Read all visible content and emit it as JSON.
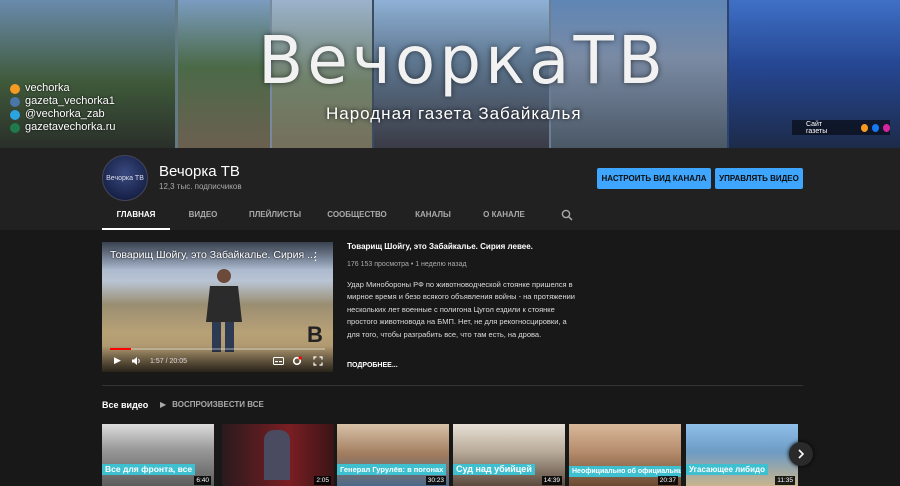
{
  "banner": {
    "title": "ВечоркаТВ",
    "subtitle": "Народная газета Забайкалья",
    "social": [
      {
        "icon": "ok-icon",
        "text": "vechorka"
      },
      {
        "icon": "vk-icon",
        "text": "gazeta_vechorka1"
      },
      {
        "icon": "telegram-icon",
        "text": "@vechorka_zab"
      },
      {
        "icon": "globe-icon",
        "text": "gazetavechorka.ru"
      }
    ],
    "site_link": "Сайт газеты"
  },
  "channel": {
    "name": "Вечорка ТВ",
    "avatar_text": "Вечорка ТВ",
    "subscribers": "12,3 тыс. подписчиков",
    "customize_label": "НАСТРОИТЬ ВИД КАНАЛА",
    "manage_label": "УПРАВЛЯТЬ ВИДЕО"
  },
  "tabs": [
    {
      "label": "ГЛАВНАЯ",
      "active": true
    },
    {
      "label": "ВИДЕО",
      "active": false
    },
    {
      "label": "ПЛЕЙЛИСТЫ",
      "active": false
    },
    {
      "label": "СООБЩЕСТВО",
      "active": false
    },
    {
      "label": "КАНАЛЫ",
      "active": false
    },
    {
      "label": "О КАНАЛЕ",
      "active": false
    }
  ],
  "featured": {
    "player_title": "Товарищ Шойгу, это Забайкалье. Сирия ...",
    "logo_text": "В",
    "time": "1:57 / 20:05",
    "progress": 0.097,
    "title": "Товарищ Шойгу, это Забайкалье. Сирия левее.",
    "meta": "176 153 просмотра • 1 неделю назад",
    "description": "Удар Минобороны РФ по животноводческой стоянке пришелся в мирное время и безо всякого объявления войны - на протяжении нескольких лет военные с полигона Цугол ездили к стоянке простого животновода на БМП. Нет, не для рекогносцировки, а для того, чтобы разграбить все, что там есть, на дрова.",
    "more_label": "ПОДРОБНЕЕ..."
  },
  "section": {
    "title": "Все видео",
    "play_all": "ВОСПРОИЗВЕСТИ ВСЕ"
  },
  "videos": [
    {
      "caption": "Все для фронта, все",
      "duration": "6:40",
      "bg": "#8c8c8c"
    },
    {
      "caption": "",
      "duration": "2:05",
      "bg": "#5a1c20"
    },
    {
      "caption": "Генерал Гурулёв: в погонах",
      "duration": "30:23",
      "bg": "#a07a5c"
    },
    {
      "caption": "Суд над убийцей",
      "duration": "14:39",
      "bg": "#b8aa98"
    },
    {
      "caption": "Неофициально об официальных",
      "duration": "20:37",
      "bg": "#b58c6c"
    },
    {
      "caption": "Угасающее либидо",
      "duration": "11:35",
      "bg": "#6d9bc4"
    }
  ],
  "colors": {
    "accent": "#3ea6ff",
    "caption_bg": "#3ec0d0",
    "progress": "#ff0000"
  }
}
